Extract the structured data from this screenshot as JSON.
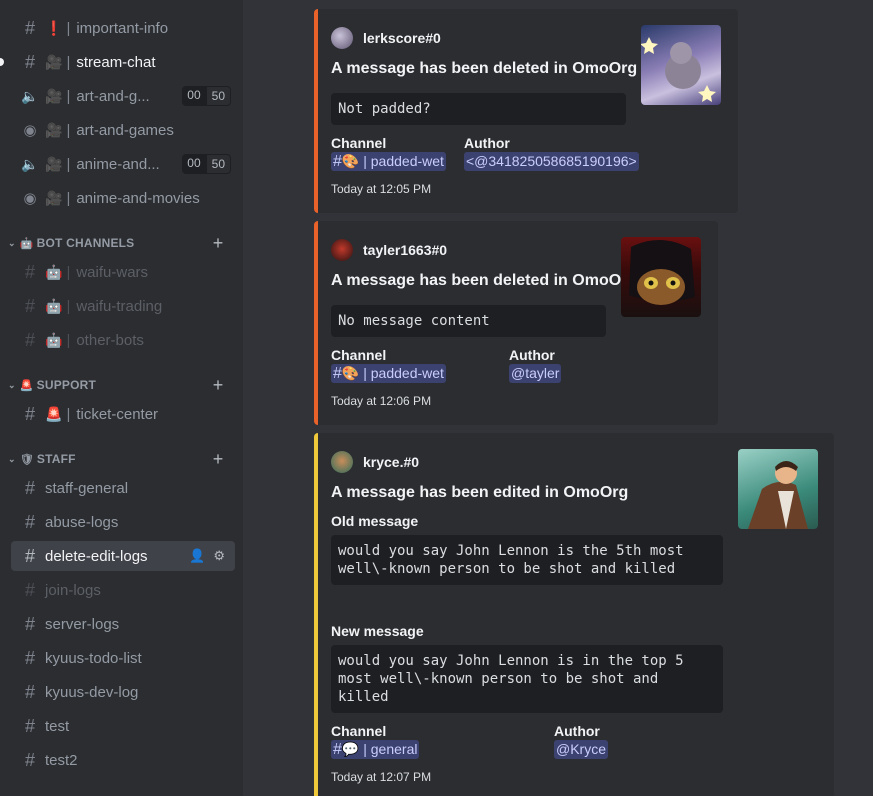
{
  "sidebar": {
    "categories": {
      "bot": "BOT CHANNELS",
      "support": "SUPPORT",
      "staff": "STAFF"
    },
    "channels": {
      "important_info": {
        "emoji": "❗",
        "name": "important-info"
      },
      "stream_chat": {
        "emoji": "🎥",
        "name": "stream-chat"
      },
      "art_voice": {
        "emoji": "🎥",
        "name": "art-and-g...",
        "count_a": "00",
        "count_b": "50"
      },
      "art_stage": {
        "emoji": "🎥",
        "name": "art-and-games"
      },
      "anime_voice": {
        "emoji": "🎥",
        "name": "anime-and...",
        "count_a": "00",
        "count_b": "50"
      },
      "anime_stage": {
        "emoji": "🎥",
        "name": "anime-and-movies"
      },
      "waifu_wars": {
        "emoji": "🤖",
        "name": "waifu-wars"
      },
      "waifu_trading": {
        "emoji": "🤖",
        "name": "waifu-trading"
      },
      "other_bots": {
        "emoji": "🤖",
        "name": "other-bots"
      },
      "ticket_center": {
        "emoji": "🚨",
        "name": "ticket-center"
      },
      "staff_general": {
        "name": "staff-general"
      },
      "abuse_logs": {
        "name": "abuse-logs"
      },
      "delete_edit_logs": {
        "name": "delete-edit-logs"
      },
      "join_logs": {
        "name": "join-logs"
      },
      "server_logs": {
        "name": "server-logs"
      },
      "kyuus_todo": {
        "name": "kyuus-todo-list"
      },
      "kyuus_dev": {
        "name": "kyuus-dev-log"
      },
      "test": {
        "name": "test"
      },
      "test2": {
        "name": "test2"
      }
    }
  },
  "embeds": [
    {
      "author": "lerkscore#0",
      "title": "A message has been deleted in OmoOrg",
      "content": "Not padded?",
      "channel_label": "Channel",
      "channel_emoji": "🎨",
      "channel_name": "padded-wet",
      "author_label": "Author",
      "author_value": "<@341825058685190196>",
      "timestamp": "Today at 12:05 PM",
      "color": "#e8622a"
    },
    {
      "author": "tayler1663#0",
      "title": "A message has been deleted in OmoOrg",
      "content": "No message content",
      "channel_label": "Channel",
      "channel_emoji": "🎨",
      "channel_name": "padded-wet",
      "author_label": "Author",
      "author_value": "@tayler",
      "timestamp": "Today at 12:06 PM",
      "color": "#e8622a"
    },
    {
      "author": "kryce.#0",
      "title": "A message has been edited in OmoOrg",
      "old_label": "Old message",
      "old_content": "would you say John Lennon is the 5th most\nwell\\-known person to be shot and killed",
      "new_label": "New message",
      "new_content": "would you say John Lennon is in the top 5\nmost well\\-known person to be shot and\nkilled",
      "channel_label": "Channel",
      "channel_emoji": "💬",
      "channel_name": "general",
      "author_label": "Author",
      "author_value": "@Kryce",
      "timestamp": "Today at 12:07 PM",
      "color": "#f0c93a"
    }
  ]
}
